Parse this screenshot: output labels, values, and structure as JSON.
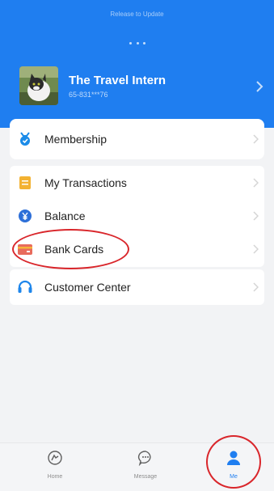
{
  "header": {
    "pull_text": "Release to Update",
    "profile": {
      "name": "The Travel Intern",
      "account_id": "65-831***76"
    }
  },
  "menu": {
    "membership": "Membership",
    "transactions": "My Transactions",
    "balance": "Balance",
    "bank_cards": "Bank Cards",
    "customer_center": "Customer Center"
  },
  "icons": {
    "membership": "badge-icon",
    "transactions": "document-icon",
    "balance": "coin-icon",
    "bank_cards": "card-icon",
    "customer_center": "headset-icon"
  },
  "bottom_nav": {
    "items": [
      {
        "label": "Home",
        "icon": "home-icon"
      },
      {
        "label": "Message",
        "icon": "chat-icon"
      },
      {
        "label": "Me",
        "icon": "person-icon",
        "active": true
      }
    ]
  },
  "colors": {
    "brand_blue": "#1f7ef0",
    "highlight_red": "#d9262b",
    "balance_blue": "#2d6fd8",
    "transactions_orange": "#f3b232",
    "bank_card_red": "#e86b5c",
    "membership_blue": "#1b8be8",
    "customer_blue": "#1e86eb"
  }
}
